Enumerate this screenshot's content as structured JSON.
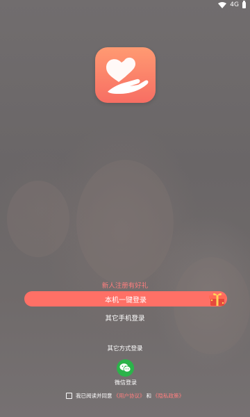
{
  "status_bar": {
    "network_label": "4G"
  },
  "login": {
    "promo_text": "新人注册有好礼",
    "primary_button": "本机一键登录",
    "other_phone_login": "其它手机登录",
    "other_methods_title": "其它方式登录",
    "wechat_label": "微信登录"
  },
  "agreement": {
    "prefix": "我已阅读并同意",
    "user_agreement": "《用户协议》",
    "conjunction": "和",
    "privacy_policy": "《隐私政策》"
  },
  "colors": {
    "brand_gradient_top": "#ff9a72",
    "brand_gradient_bottom": "#f76e63",
    "primary_button": "#ff7066",
    "link": "#ff7f7f",
    "wechat": "#2bb34a"
  },
  "icons": {
    "logo": "heart-in-hand-icon",
    "gift": "gift-box-icon",
    "wechat": "wechat-icon"
  }
}
